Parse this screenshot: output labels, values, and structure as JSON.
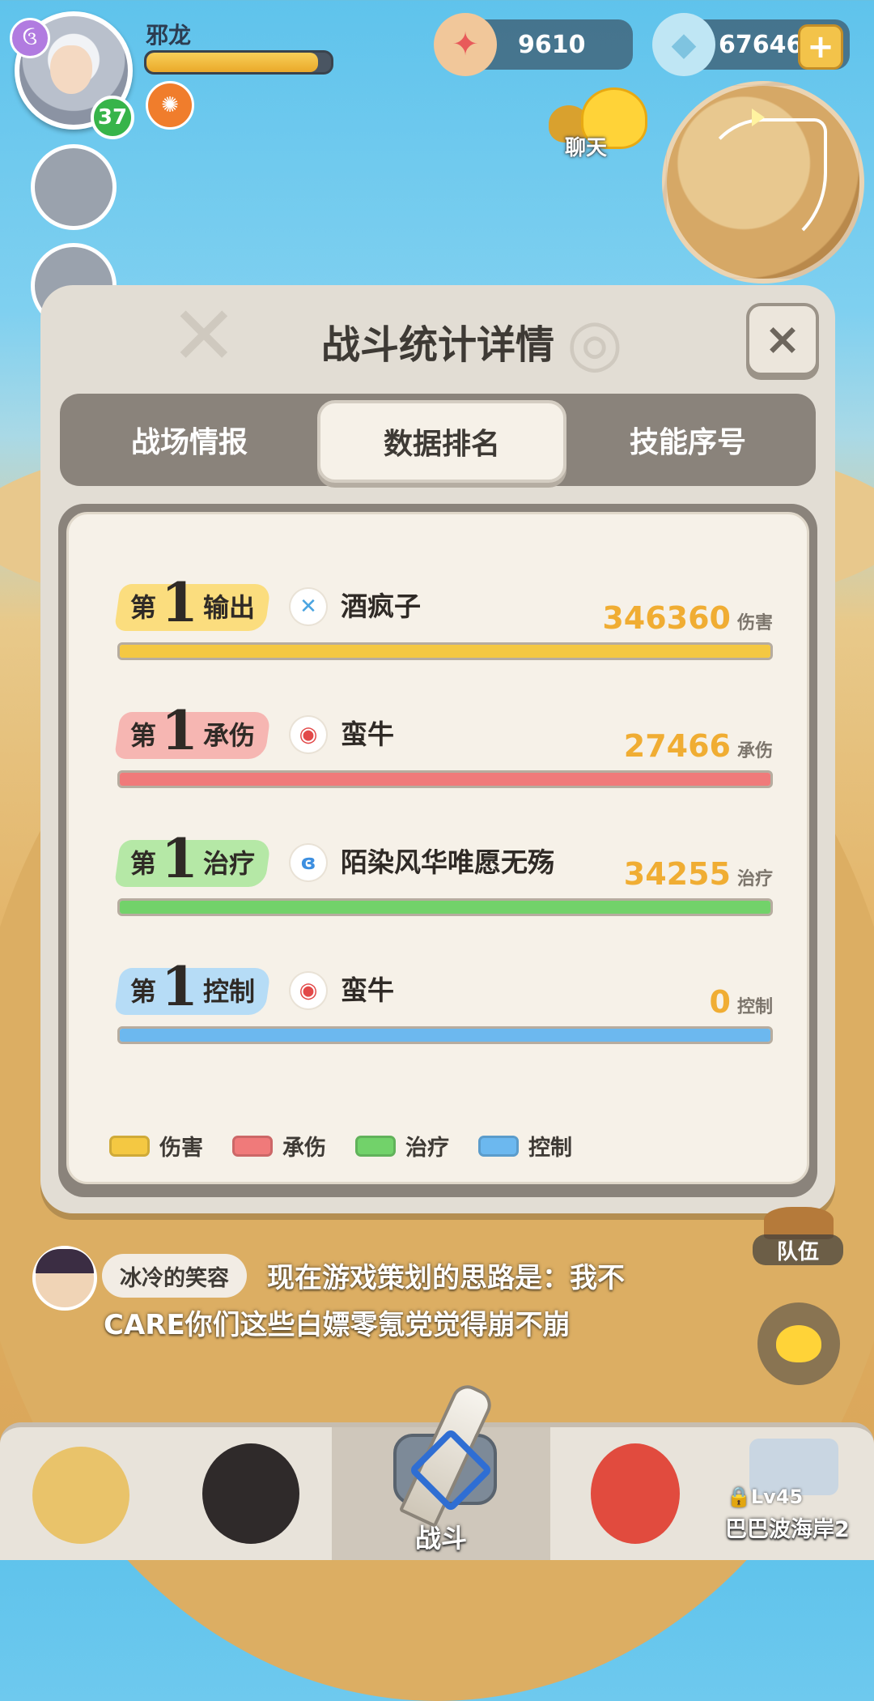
{
  "player": {
    "name": "邪龙",
    "level": "37",
    "hp_fraction": 0.93,
    "class_icon": "spiral-icon"
  },
  "currency": {
    "pearls": "9610",
    "shells": "676467",
    "add_symbol": "+"
  },
  "chat_shortcut": {
    "label": "聊天"
  },
  "modal": {
    "title": "战斗统计详情",
    "close_symbol": "×",
    "tabs": [
      {
        "label": "战场情报",
        "active": false
      },
      {
        "label": "数据排名",
        "active": true
      },
      {
        "label": "技能序号",
        "active": false
      }
    ],
    "rank_prefix": "第",
    "rankings": [
      {
        "rank": "1",
        "category": "输出",
        "player": "酒疯子",
        "value": "346360",
        "unit": "伤害",
        "color": "#f4c842",
        "tag_color": "#fbdd7e",
        "icon": "sword-class-icon",
        "icon_color": "#4aa4e0",
        "icon_glyph": "✕",
        "fill": 1.0
      },
      {
        "rank": "1",
        "category": "承伤",
        "player": "蛮牛",
        "value": "27466",
        "unit": "承伤",
        "color": "#f07a7a",
        "tag_color": "#f6b6b2",
        "icon": "guardian-class-icon",
        "icon_color": "#e24949",
        "icon_glyph": "◉",
        "fill": 1.0
      },
      {
        "rank": "1",
        "category": "治疗",
        "player": "陌染风华唯愿无殇",
        "value": "34255",
        "unit": "治疗",
        "color": "#72d26a",
        "tag_color": "#b5e8a6",
        "icon": "healer-class-icon",
        "icon_color": "#3d8fe0",
        "icon_glyph": "ɞ",
        "fill": 1.0
      },
      {
        "rank": "1",
        "category": "控制",
        "player": "蛮牛",
        "value": "0",
        "unit": "控制",
        "color": "#6cb8ef",
        "tag_color": "#b6dcf6",
        "icon": "guardian-class-icon",
        "icon_color": "#e24949",
        "icon_glyph": "◉",
        "fill": 1.0
      }
    ],
    "legend": [
      {
        "label": "伤害",
        "color": "#f4c842"
      },
      {
        "label": "承伤",
        "color": "#f07a7a"
      },
      {
        "label": "治疗",
        "color": "#72d26a"
      },
      {
        "label": "控制",
        "color": "#6cb8ef"
      }
    ]
  },
  "chat": {
    "sender": "冰冷的笑容",
    "message_line1": "现在游戏策划的思路是：我不",
    "message_line2": "CARE你们这些白嫖零氪党觉得崩不崩"
  },
  "team": {
    "label": "队伍"
  },
  "bottom_nav": {
    "battle_label": "战斗",
    "locked_level": "Lv45",
    "location": "巴巴波海岸2"
  }
}
